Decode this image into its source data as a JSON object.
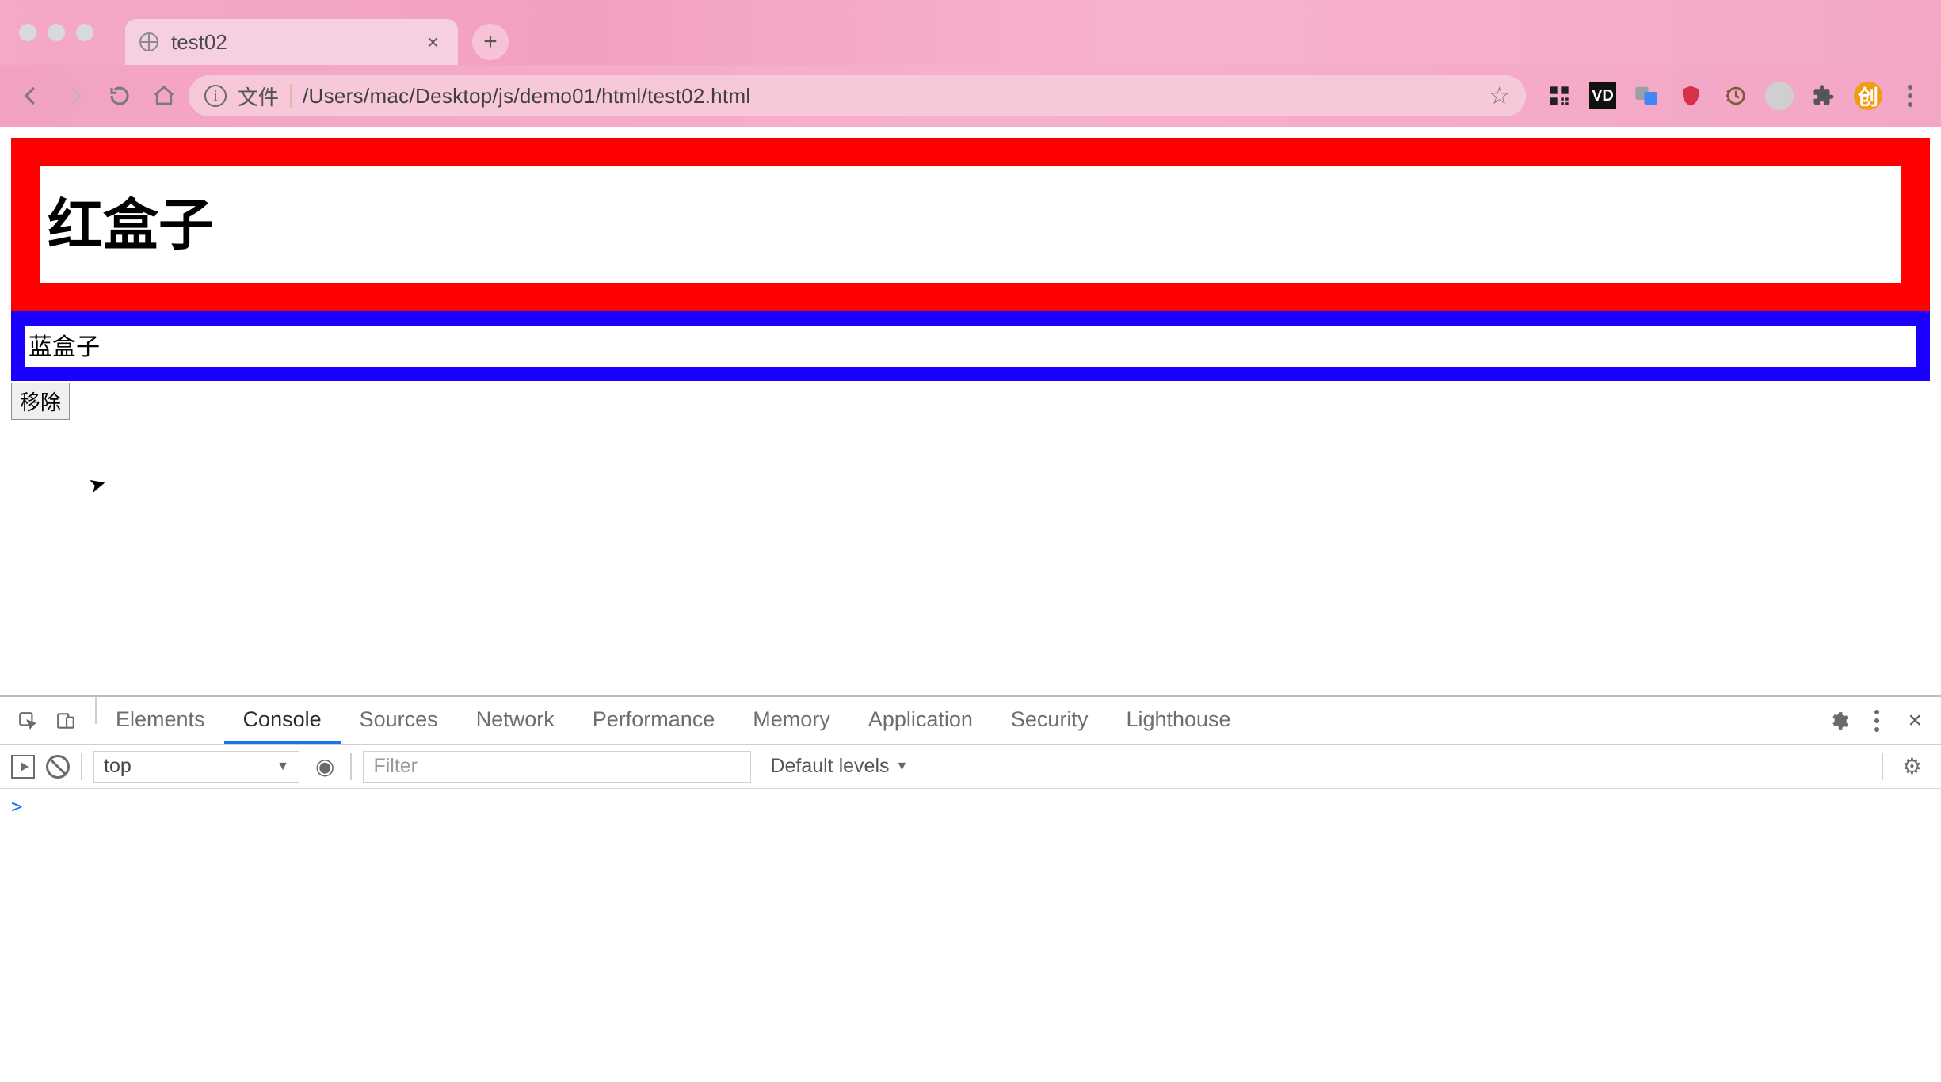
{
  "browser": {
    "tab_title": "test02",
    "url_label": "文件",
    "url_path": "/Users/mac/Desktop/js/demo01/html/test02.html"
  },
  "page": {
    "red_box_text": "红盒子",
    "blue_box_text": "蓝盒子",
    "remove_button_label": "移除"
  },
  "devtools": {
    "tabs": {
      "elements": "Elements",
      "console": "Console",
      "sources": "Sources",
      "network": "Network",
      "performance": "Performance",
      "memory": "Memory",
      "application": "Application",
      "security": "Security",
      "lighthouse": "Lighthouse"
    },
    "active_tab": "console",
    "context_value": "top",
    "filter_placeholder": "Filter",
    "levels_label": "Default levels",
    "prompt": ">"
  }
}
